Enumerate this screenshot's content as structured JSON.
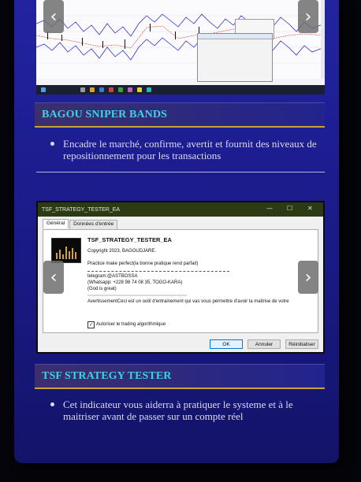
{
  "sections": [
    {
      "title": "BAGOU SNIPER BANDS",
      "description": "Encadre le marché, confirme, avertit et fournit des niveaux de repositionnement pour les transactions"
    },
    {
      "title": "TSF STRATEGY TESTER",
      "description": "Cet indicateur vous aiderra à pratiquer le systeme et à le maitriser avant de passer sur un compte réel"
    }
  ],
  "carousel": {
    "prev_icon": "‹",
    "next_icon": "›"
  },
  "tester_dialog": {
    "title": "TSF_STRATEGY_TESTER_EA",
    "window_controls": {
      "minimize": "—",
      "maximize": "☐",
      "close": "✕"
    },
    "tabs": [
      {
        "label": "Général"
      },
      {
        "label": "Données d'entrée"
      }
    ],
    "name": "TSF_STRATEGY_TESTER_EA",
    "copyright": "Copyright 2023, BAGOUDJARE.",
    "motto": "Practice make perfect(la bonne pratique rend parfait)",
    "separator": "================================================",
    "telegram": "telegram:@ASTBOSSA",
    "whatsapp": "(Whatsapp: +228 98 74 08 35,  TOGO-KARA)",
    "god": "(God is great)",
    "warning": "AvertissementCeci est un outil d'entrainement qui vas vous permettre d'avoir la maitrise de votre",
    "checkbox_label": "Autoriser le trading algorithmique",
    "checkbox_checked": "✓",
    "buttons": {
      "ok": "OK",
      "cancel": "Annuler",
      "reset": "Réinitialiser"
    }
  },
  "colors": {
    "panel": "#1c1c8e",
    "title_text": "#3fd2df",
    "title_border": "#c8a23a",
    "body_text": "#d9dbef",
    "dialog_titlebar": "#2d3b14"
  }
}
